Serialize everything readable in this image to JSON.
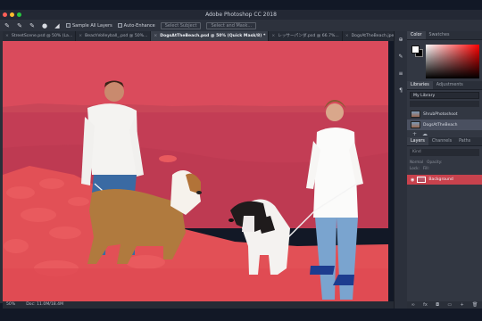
{
  "app": {
    "title": "Adobe Photoshop CC 2018"
  },
  "options": {
    "sample_all_layers": "Sample All Layers",
    "auto_enhance": "Auto-Enhance",
    "select_subject": "Select Subject",
    "select_and_mask": "Select and Mask..."
  },
  "tabs": [
    {
      "label": "StreetScene.psd @ 50% (La...",
      "active": false
    },
    {
      "label": "BeachVolleyball_.psd @ 50%...",
      "active": false
    },
    {
      "label": "DogsAtTheBeach.psd @ 50% (Quick Mask/8) *",
      "active": true
    },
    {
      "label": "レッサーパンダ.psd @ 66.7%...",
      "active": false
    },
    {
      "label": "DogsAtTheBeach.jpeg @ 5...",
      "active": false
    }
  ],
  "status": {
    "zoom": "50%",
    "doc": "Doc: 11.0M/18.4M"
  },
  "panels": {
    "color_tabs": [
      "Color",
      "Swatches"
    ],
    "library_tabs": [
      "Libraries",
      "Adjustments"
    ],
    "library_select": "My Library",
    "library_items": [
      {
        "label": "ShrubPhotoshoot",
        "selected": false
      },
      {
        "label": "DogsAtTheBeach",
        "selected": true
      }
    ],
    "layer_tabs": [
      "Layers",
      "Channels",
      "Paths"
    ],
    "layer_kind": "Kind",
    "layer_mode": "Normal",
    "opacity_label": "Opacity:",
    "lock_label": "Lock:",
    "fill_label": "Fill:",
    "layers": [
      {
        "name": "Background",
        "visible": true
      }
    ]
  },
  "colors": {
    "quick_mask": "#d9414f",
    "panel_bg": "#323742",
    "active_layer": "#c8424d"
  }
}
